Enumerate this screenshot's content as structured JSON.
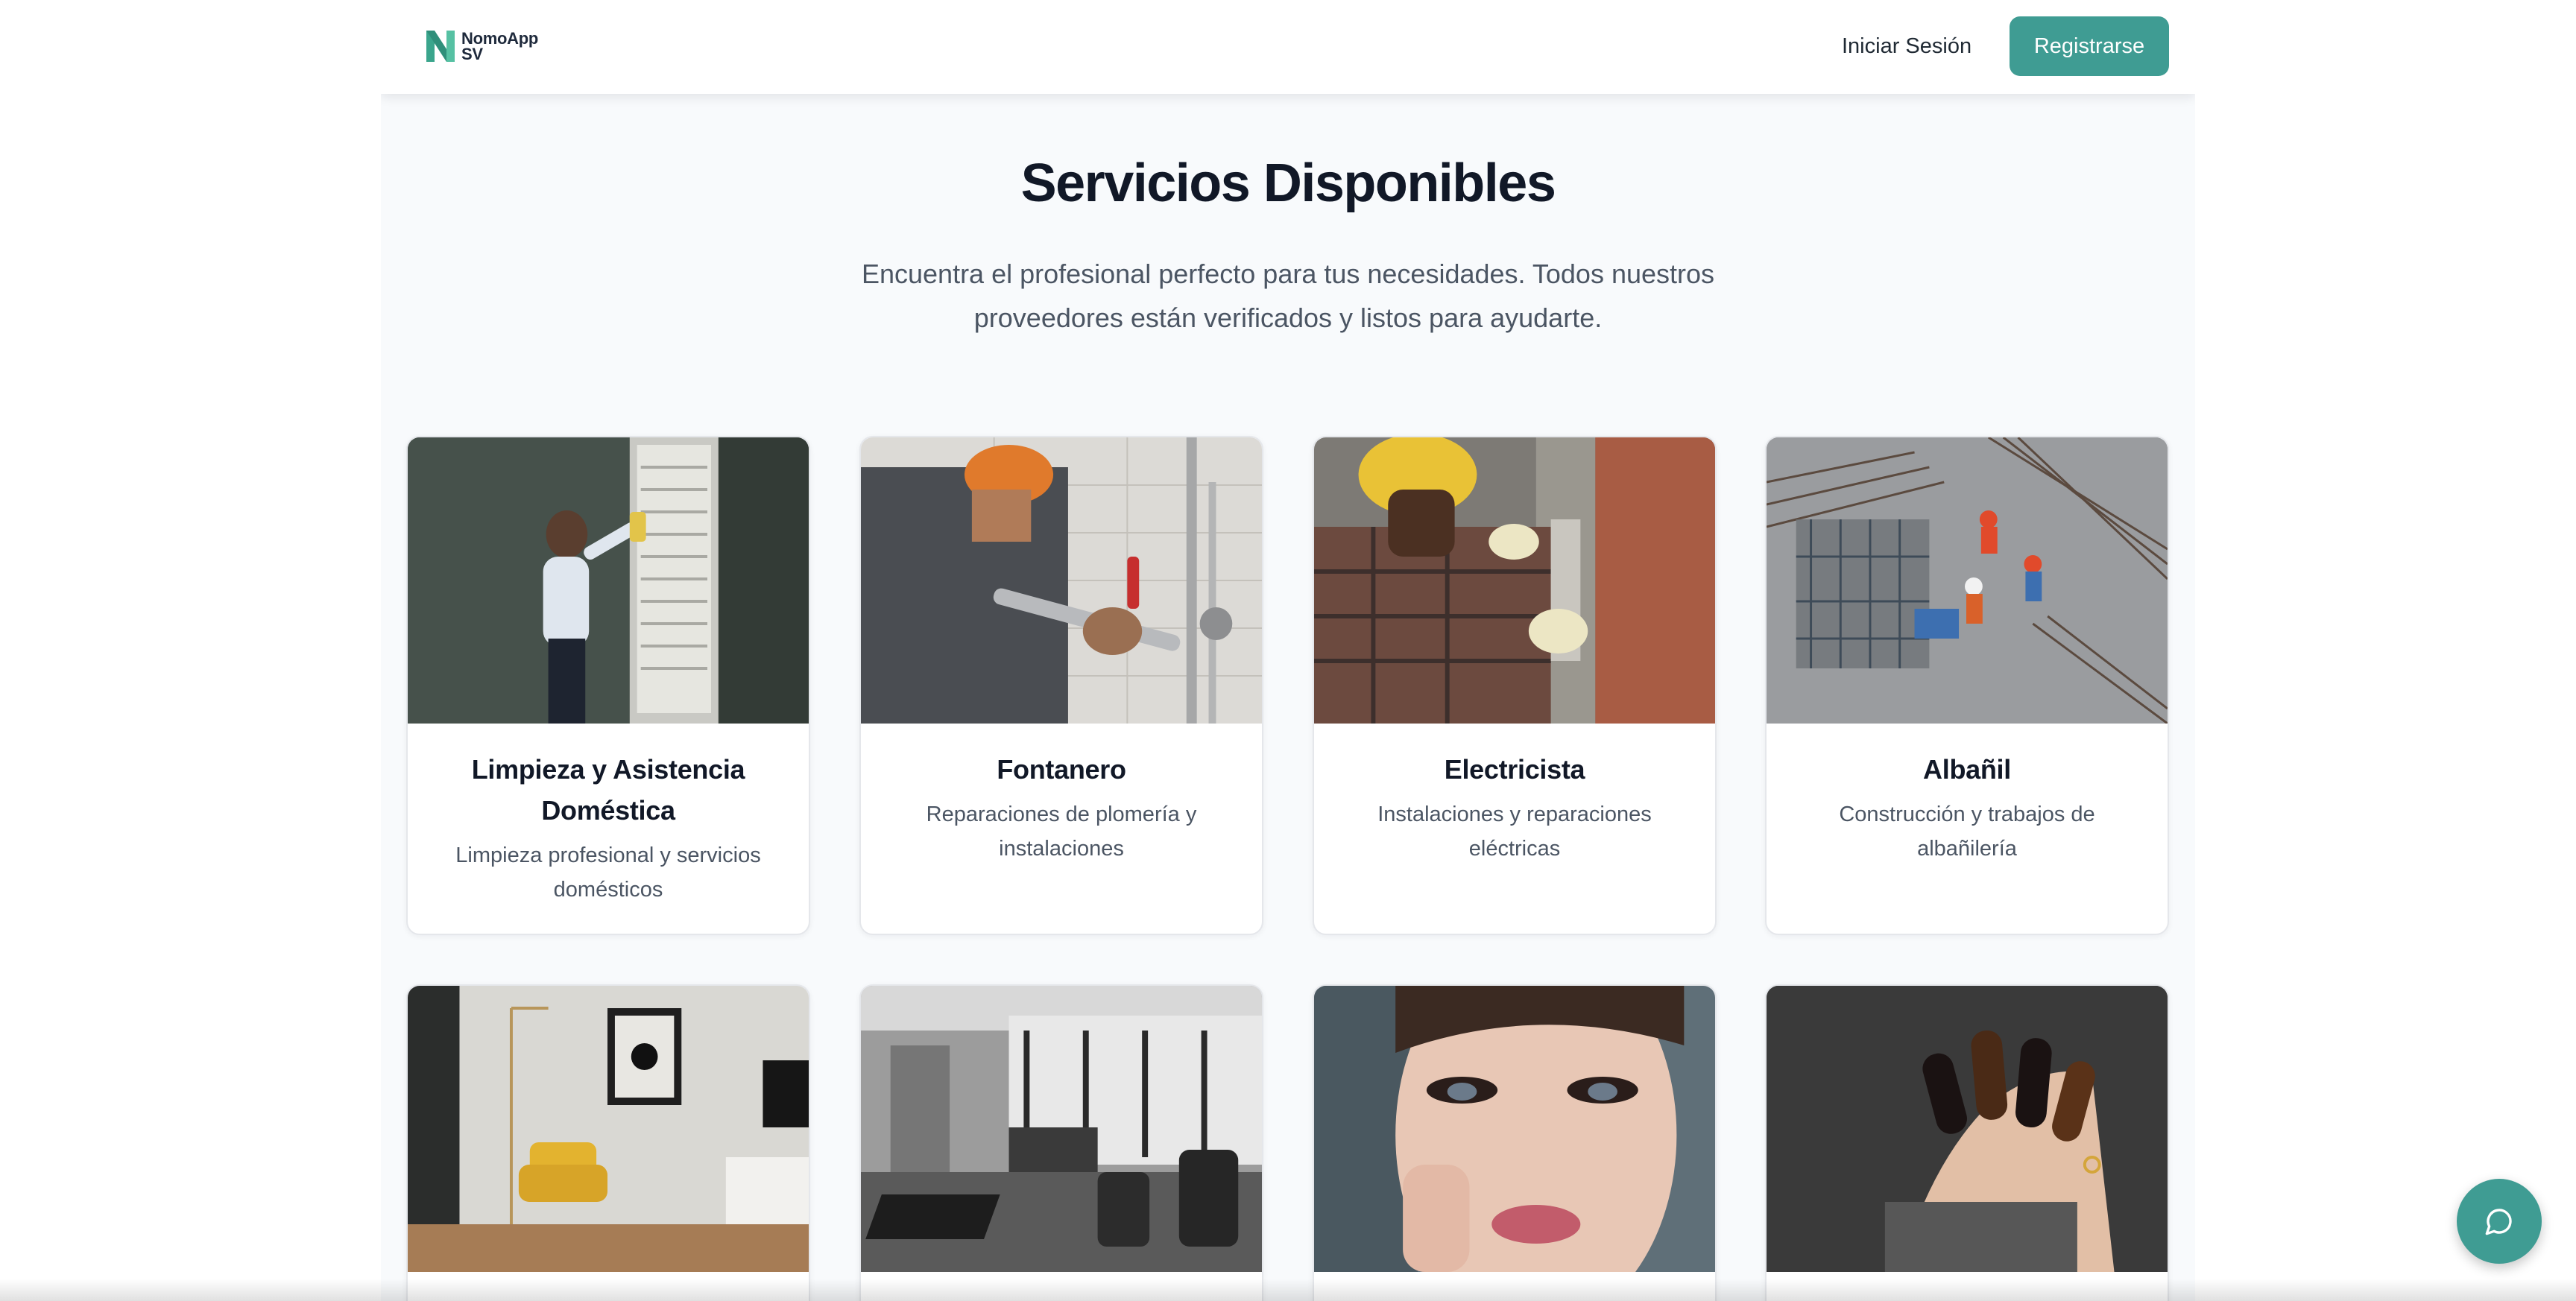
{
  "header": {
    "logo_line1": "NomoApp",
    "logo_line2": "SV",
    "login_label": "Iniciar Sesión",
    "register_label": "Registrarse"
  },
  "hero": {
    "title": "Servicios Disponibles",
    "subtitle": "Encuentra el profesional perfecto para tus necesidades. Todos nuestros proveedores están verificados y listos para ayudarte."
  },
  "services": [
    {
      "title": "Limpieza y Asistencia Doméstica",
      "description": "Limpieza profesional y servicios domésticos",
      "image": "cleaning-photo"
    },
    {
      "title": "Fontanero",
      "description": "Reparaciones de plomería y instalaciones",
      "image": "plumber-photo"
    },
    {
      "title": "Electricista",
      "description": "Instalaciones y reparaciones eléctricas",
      "image": "electrician-photo"
    },
    {
      "title": "Albañil",
      "description": "Construcción y trabajos de albañilería",
      "image": "construction-photo"
    },
    {
      "image": "interior-design-photo"
    },
    {
      "image": "barber-salon-photo"
    },
    {
      "image": "makeup-photo"
    },
    {
      "image": "nails-photo"
    }
  ],
  "colors": {
    "brand": "#3f9c93",
    "page_background": "#f8fafc",
    "title_text": "#111827",
    "body_text": "#4b5563"
  },
  "icons": {
    "logo": "n-logo-icon",
    "chat": "chat-bubble-icon"
  }
}
